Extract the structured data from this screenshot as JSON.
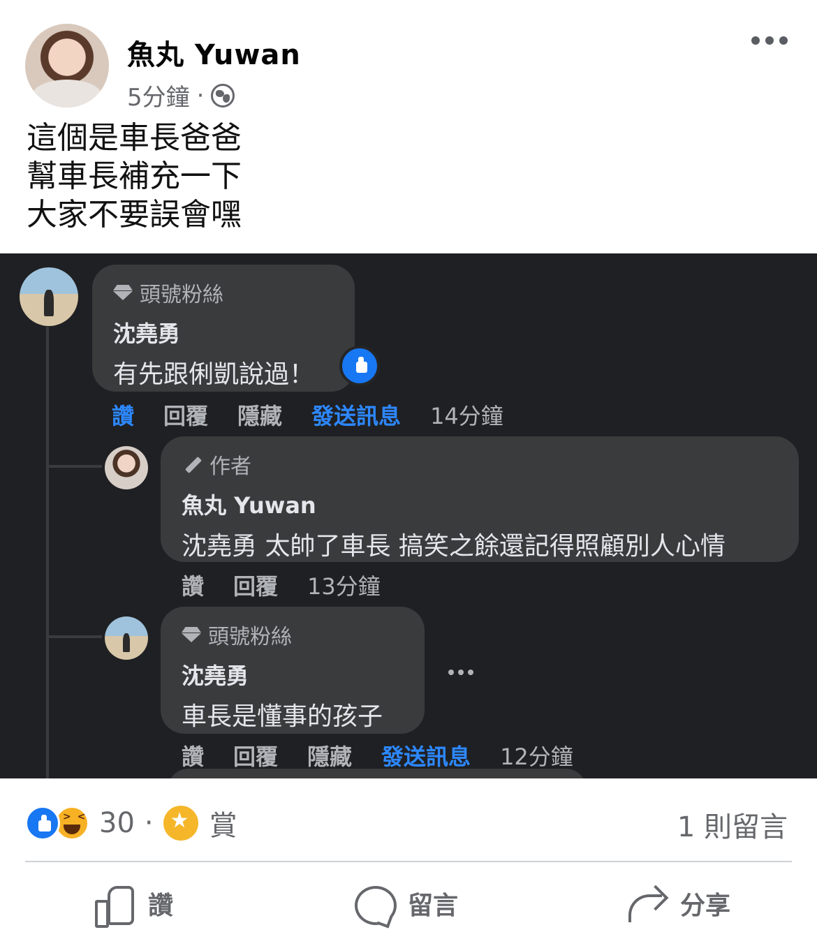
{
  "post": {
    "author": "魚丸 Yuwan",
    "time": "5分鐘",
    "separator": "·",
    "text_lines": [
      "這個是車長爸爸",
      "幫車長補充一下",
      "大家不要誤會嘿"
    ]
  },
  "screenshot": {
    "comments": [
      {
        "badge": "頭號粉絲",
        "name": "沈堯勇",
        "text": "有先跟俐凱說過！",
        "actions": [
          "讚",
          "回覆",
          "隱藏",
          "發送訊息"
        ],
        "time": "14分鐘"
      },
      {
        "badge": "作者",
        "name": "魚丸 Yuwan",
        "text": "沈堯勇 太帥了車長 搞笑之餘還記得照顧別人心情",
        "actions": [
          "讚",
          "回覆"
        ],
        "time": "13分鐘"
      },
      {
        "badge": "頭號粉絲",
        "name": "沈堯勇",
        "text": "車長是懂事的孩子",
        "actions": [
          "讚",
          "回覆",
          "隱藏",
          "發送訊息"
        ],
        "time": "12分鐘"
      }
    ]
  },
  "reactions": {
    "count": "30",
    "separator": "·",
    "stars_label": "賞",
    "comments_count": "1 則留言"
  },
  "action_bar": {
    "like": "讚",
    "comment": "留言",
    "share": "分享"
  },
  "colors": {
    "blue": "#1877f2",
    "dark_bg": "#1f2023",
    "bubble": "#3a3b3c",
    "muted": "#65676b"
  }
}
